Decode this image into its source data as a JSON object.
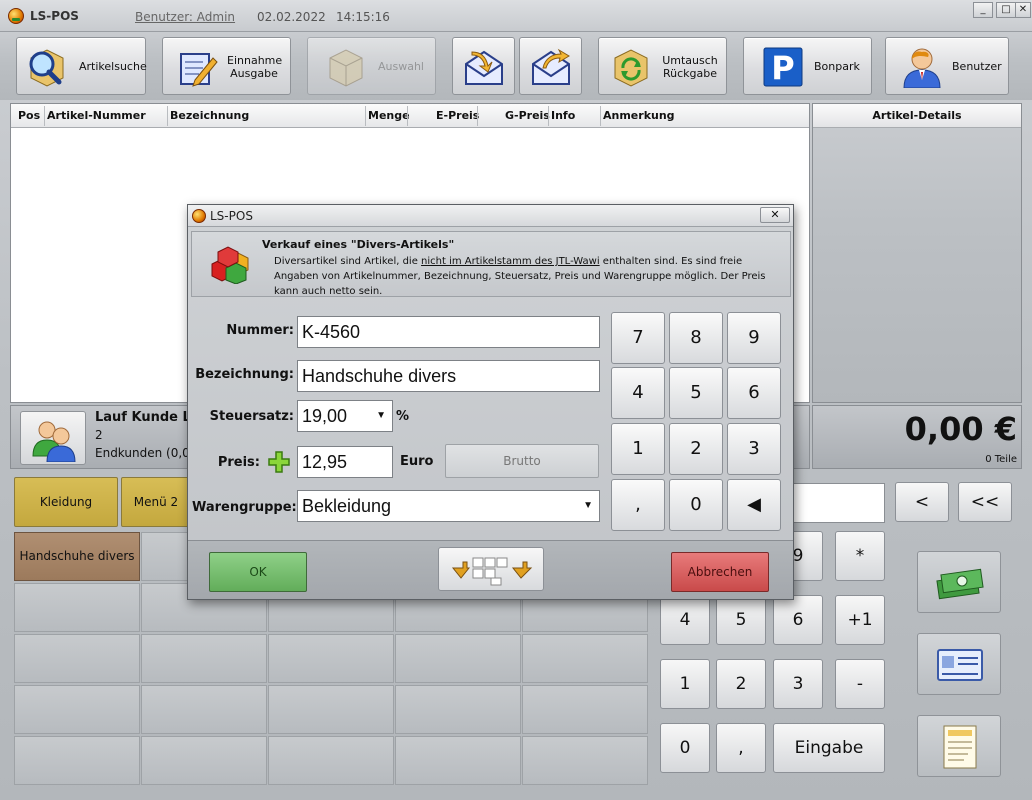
{
  "app": {
    "title": "LS-POS",
    "user": "Benutzer: Admin",
    "date": "02.02.2022",
    "time": "14:15:16"
  },
  "toolbar": {
    "artikelsuche": "Artikelsuche",
    "einnahme_line1": "Einnahme",
    "einnahme_line2": "Ausgabe",
    "auswahl": "Auswahl",
    "umtausch_line1": "Umtausch",
    "umtausch_line2": "Rückgabe",
    "bonpark": "Bonpark",
    "benutzer": "Benutzer"
  },
  "table": {
    "columns": [
      "Pos",
      "Artikel-Nummer",
      "Bezeichnung",
      "Menge",
      "E-Preis",
      "G-Preis",
      "Info",
      "Anmerkung"
    ]
  },
  "details": {
    "title": "Artikel-Details"
  },
  "customer": {
    "name": "Lauf Kunde La",
    "number": "2",
    "group": "Endkunden (0,0"
  },
  "total": {
    "amount": "0,00 €",
    "parts": "0 Teile"
  },
  "categories": [
    {
      "label": "Kleidung"
    },
    {
      "label": "Menü 2"
    }
  ],
  "products": [
    {
      "label": "Handschuhe divers"
    }
  ],
  "bg_numpad": {
    "keys": [
      "<",
      "<<",
      "9",
      "*",
      "4",
      "5",
      "6",
      "+1",
      "1",
      "2",
      "3",
      "-",
      "0",
      ",",
      "Eingabe"
    ]
  },
  "dialog": {
    "title": "LS-POS",
    "close": "✕",
    "info_heading": "Verkauf eines \"Divers-Artikels\"",
    "info_text_a": "Diversartikel sind Artikel, die ",
    "info_text_link": "nicht im Artikelstamm des JTL-Wawi",
    "info_text_b": " enthalten sind. Es sind freie Angaben von Artikelnummer, Bezeichnung, Steuersatz, Preis und Warengruppe möglich. Der Preis kann auch netto sein.",
    "labels": {
      "nummer": "Nummer:",
      "bezeichnung": "Bezeichnung:",
      "steuersatz": "Steuersatz:",
      "preis": "Preis:",
      "warengruppe": "Warengruppe:"
    },
    "values": {
      "nummer": "K-4560",
      "bezeichnung": "Handschuhe divers",
      "steuersatz": "19,00",
      "preis": "12,95",
      "warengruppe": "Bekleidung"
    },
    "units": {
      "percent": "%",
      "euro": "Euro"
    },
    "brutto": "Brutto",
    "keypad": [
      "7",
      "8",
      "9",
      "4",
      "5",
      "6",
      "1",
      "2",
      "3",
      ",",
      "0",
      "◀"
    ],
    "ok": "OK",
    "cancel": "Abbrechen"
  },
  "colors": {
    "category": "#c9ad44",
    "product": "#a5836a",
    "ok": "#6fbb66",
    "cancel": "#d45a5a"
  }
}
